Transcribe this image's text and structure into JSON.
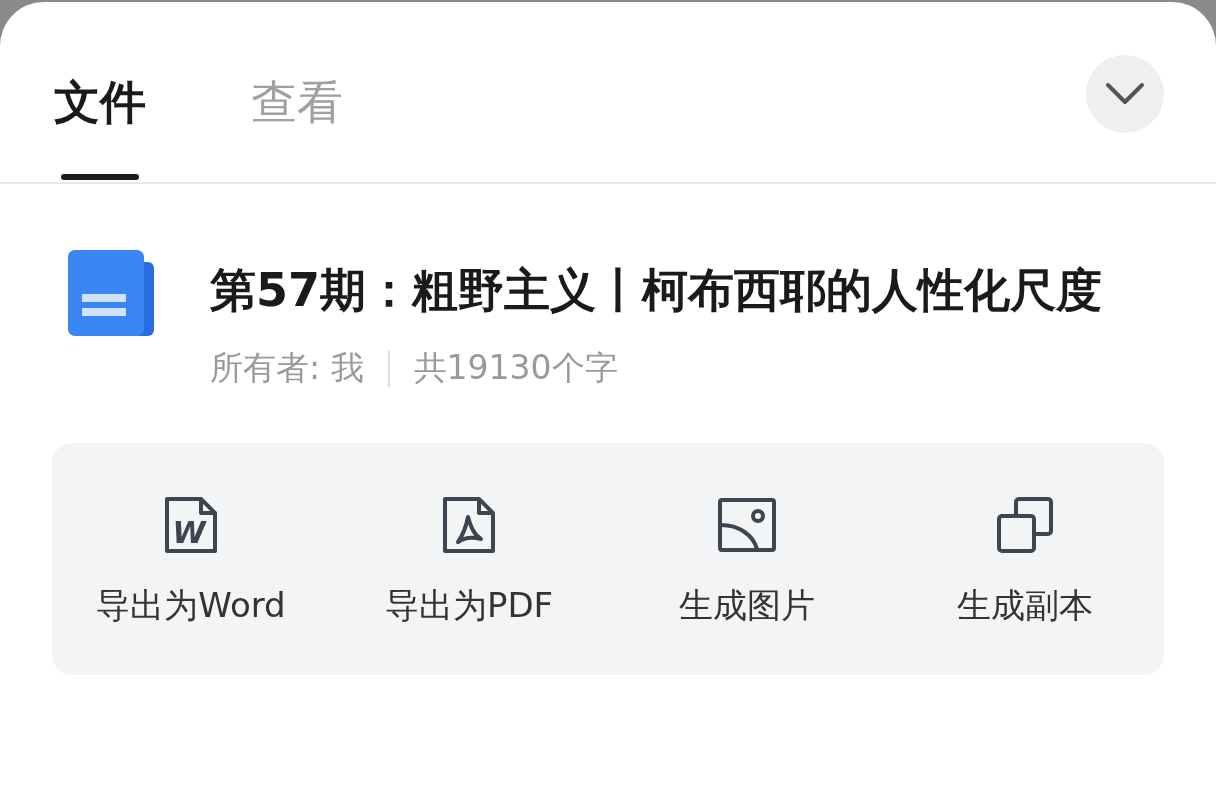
{
  "tabs": [
    {
      "label": "文件",
      "selected": true
    },
    {
      "label": "查看",
      "selected": false
    }
  ],
  "document": {
    "title": "第57期：粗野主义丨柯布西耶的人性化尺度",
    "owner": "所有者: 我",
    "word_count": "共19130个字"
  },
  "actions": [
    {
      "kind": "word",
      "icon_text": "W",
      "label": "导出为Word"
    },
    {
      "kind": "pdf",
      "label": "导出为PDF"
    },
    {
      "kind": "image",
      "label": "生成图片"
    },
    {
      "kind": "copy",
      "label": "生成副本"
    }
  ]
}
